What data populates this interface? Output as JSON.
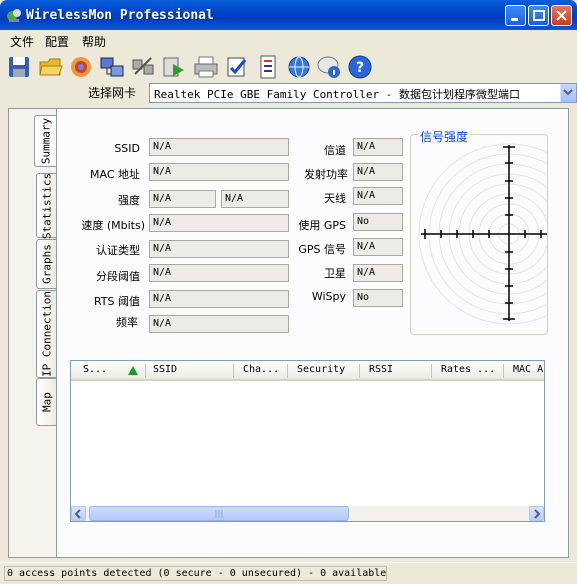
{
  "window": {
    "title": "WirelessMon Professional"
  },
  "menu": [
    "文件",
    "配置",
    "帮助"
  ],
  "toolbar": {
    "icons": [
      "save-icon",
      "open-folder-icon",
      "record-icon",
      "network-icon",
      "disconnect-icon",
      "play-icon",
      "printer-icon",
      "checklist-icon",
      "document-icon",
      "globe-icon",
      "info-bubble-icon",
      "help-icon"
    ]
  },
  "nic": {
    "label": "选择网卡",
    "selected": "Realtek PCIe GBE Family Controller - 数据包计划程序微型端口"
  },
  "tabs": [
    "Summary",
    "Statistics",
    "Graphs",
    "IP Connection",
    "Map"
  ],
  "fields": {
    "ssid": {
      "label": "SSID",
      "value": "N/A"
    },
    "mac": {
      "label": "MAC 地址",
      "value": "N/A"
    },
    "strength": {
      "label": "强度",
      "value1": "N/A",
      "value2": "N/A"
    },
    "speed": {
      "label": "速度 (Mbits)",
      "value": "N/A"
    },
    "auth": {
      "label": "认证类型",
      "value": "N/A"
    },
    "frag": {
      "label": "分段阈值",
      "value": "N/A"
    },
    "rts": {
      "label": "RTS 阈值",
      "value": "N/A"
    },
    "freq": {
      "label": "频率",
      "value": "N/A"
    },
    "channel": {
      "label": "信道",
      "value": "N/A"
    },
    "txpower": {
      "label": "发射功率",
      "value": "N/A"
    },
    "antenna": {
      "label": "天线",
      "value": "N/A"
    },
    "use_gps": {
      "label": "使用 GPS",
      "value": "No"
    },
    "gps_signal": {
      "label": "GPS 信号",
      "value": "N/A"
    },
    "satellite": {
      "label": "卫星",
      "value": "N/A"
    },
    "wispy": {
      "label": "WiSpy",
      "value": "No"
    }
  },
  "signal": {
    "title": "信号强度"
  },
  "list": {
    "columns": [
      "S...",
      "SSID",
      "Cha...",
      "Security",
      "RSSI",
      "Rates ...",
      "MAC A"
    ]
  },
  "status": "0 access points detected (0 secure - 0 unsecured) - 0 available",
  "colors": {
    "titlebar": "#0044c9",
    "accent_text": "#0046d5",
    "sort_arrow": "#1a9a2a"
  }
}
